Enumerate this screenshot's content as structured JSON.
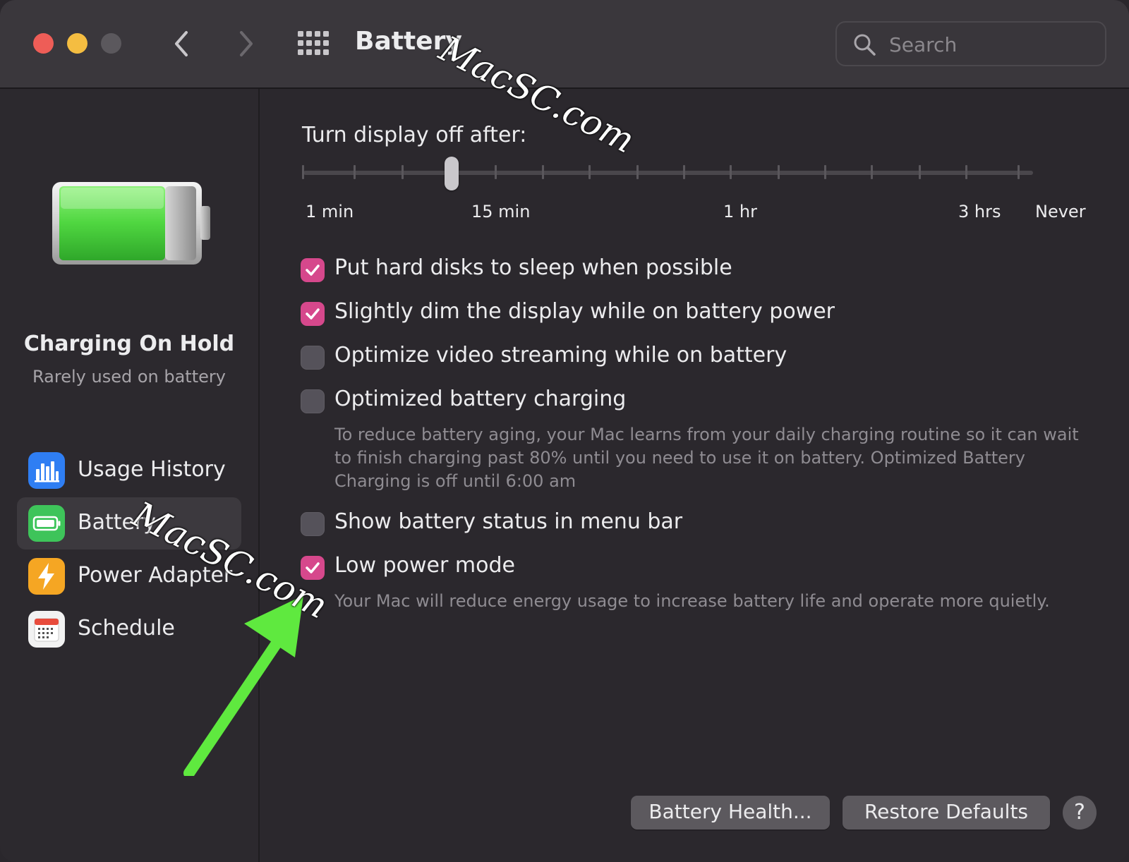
{
  "window": {
    "title": "Battery",
    "search_placeholder": "Search"
  },
  "sidebar": {
    "status_title": "Charging On Hold",
    "status_subtitle": "Rarely used on battery",
    "items": [
      {
        "label": "Usage History",
        "icon": "bar-chart-icon",
        "color": "#2f7ef3"
      },
      {
        "label": "Battery",
        "icon": "battery-icon",
        "color": "#3ec45a",
        "selected": true
      },
      {
        "label": "Power Adapter",
        "icon": "lightning-icon",
        "color": "#f5a623"
      },
      {
        "label": "Schedule",
        "icon": "calendar-icon",
        "color": "#f2f2f2"
      }
    ]
  },
  "main": {
    "slider": {
      "label": "Turn display off after:",
      "tick_labels": [
        "1 min",
        "15 min",
        "1 hr",
        "3 hrs",
        "Never"
      ],
      "value": "15 min"
    },
    "options": [
      {
        "label": "Put hard disks to sleep when possible",
        "checked": true
      },
      {
        "label": "Slightly dim the display while on battery power",
        "checked": true
      },
      {
        "label": "Optimize video streaming while on battery",
        "checked": false
      },
      {
        "label": "Optimized battery charging",
        "checked": false,
        "description": "To reduce battery aging, your Mac learns from your daily charging routine so it can wait to finish charging past 80% until you need to use it on battery. Optimized Battery Charging is off until 6:00 am"
      },
      {
        "label": "Show battery status in menu bar",
        "checked": false
      },
      {
        "label": "Low power mode",
        "checked": true,
        "description": "Your Mac will reduce energy usage to increase battery life and operate more quietly."
      }
    ],
    "buttons": {
      "battery_health": "Battery Health...",
      "restore_defaults": "Restore Defaults",
      "help": "?"
    }
  },
  "colors": {
    "checkbox_on": "#d6488c",
    "battery_fill": "#5ee04a",
    "annotation_arrow": "#5fe93f"
  },
  "watermark": "MacSC.com"
}
